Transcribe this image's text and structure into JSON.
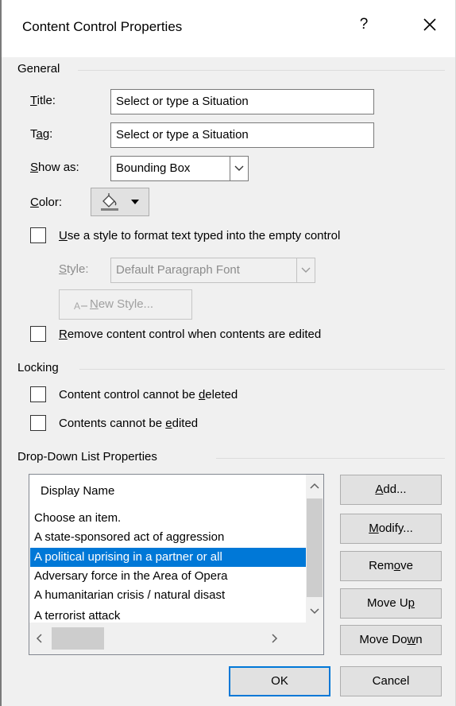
{
  "dialog": {
    "title": "Content Control Properties",
    "help_glyph": "?",
    "close_icon": "close-icon"
  },
  "general": {
    "section_label": "General",
    "title_label": "Title:",
    "title_value": "Select or type a Situation",
    "tag_label": "Tag:",
    "tag_value": "Select or type a Situation",
    "show_as_label": "Show as:",
    "show_as_value": "Bounding Box",
    "color_label": "Color:",
    "use_style_label": "Use a style to format text typed into the empty control",
    "use_style_checked": false,
    "style_label": "Style:",
    "style_value": "Default Paragraph Font",
    "new_style_label": "New Style...",
    "remove_cc_label": "Remove content control when contents are edited",
    "remove_cc_checked": false
  },
  "locking": {
    "section_label": "Locking",
    "cannot_delete_label": "Content control cannot be deleted",
    "cannot_delete_checked": false,
    "cannot_edit_label": "Contents cannot be edited",
    "cannot_edit_checked": false
  },
  "dropdown": {
    "section_label": "Drop-Down List Properties",
    "column_header": "Display Name",
    "items": [
      {
        "label": "Choose an item.",
        "selected": false
      },
      {
        "label": "A state-sponsored act of aggression",
        "selected": false
      },
      {
        "label": "A political uprising in a partner or all",
        "selected": true
      },
      {
        "label": "Adversary force in the Area of Opera",
        "selected": false
      },
      {
        "label": "A humanitarian crisis / natural disast",
        "selected": false
      },
      {
        "label": "A terrorist attack",
        "selected": false
      }
    ],
    "buttons": {
      "add": "Add...",
      "modify": "Modify...",
      "remove": "Remove",
      "move_up": "Move Up",
      "move_down": "Move Down"
    }
  },
  "footer": {
    "ok": "OK",
    "cancel": "Cancel"
  },
  "colors": {
    "selection": "#0078d7",
    "default_button_border": "#0078d7"
  }
}
